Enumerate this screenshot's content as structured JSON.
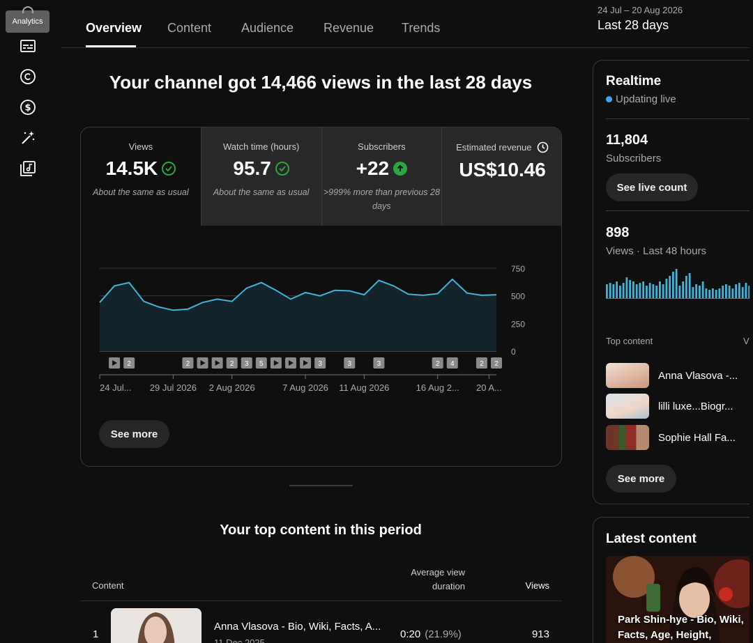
{
  "rail": {
    "tooltip": "Analytics",
    "icons": [
      "subtitles-icon",
      "copyright-icon",
      "earn-icon",
      "customization-icon",
      "audio-library-icon"
    ]
  },
  "tabs": [
    "Overview",
    "Content",
    "Audience",
    "Revenue",
    "Trends"
  ],
  "active_tab": "Overview",
  "date_range": {
    "range": "24 Jul – 20 Aug 2026",
    "label": "Last 28 days"
  },
  "headline": "Your channel got 14,466 views in the last 28 days",
  "metrics": [
    {
      "label": "Views",
      "value": "14.5K",
      "note": "About the same as usual",
      "status": "check"
    },
    {
      "label": "Watch time (hours)",
      "value": "95.7",
      "note": "About the same as usual",
      "status": "check"
    },
    {
      "label": "Subscribers",
      "value": "+22",
      "note": ">999% more than previous 28 days",
      "status": "up"
    },
    {
      "label": "Estimated revenue",
      "value": "US$10.46",
      "note": "",
      "status": "clock"
    }
  ],
  "chart_data": {
    "type": "area",
    "x_tick_labels": [
      "24 Jul...",
      "29 Jul 2026",
      "2 Aug 2026",
      "7 Aug 2026",
      "11 Aug 2026",
      "16 Aug 2...",
      "20 A..."
    ],
    "y_ticks": [
      0,
      250,
      500,
      750
    ],
    "ylim": [
      0,
      750
    ],
    "grid": true,
    "series": [
      {
        "values": [
          440,
          590,
          620,
          450,
          400,
          370,
          380,
          440,
          470,
          450,
          570,
          620,
          550,
          470,
          530,
          500,
          550,
          545,
          510,
          640,
          590,
          515,
          505,
          520,
          650,
          525,
          505,
          510
        ]
      }
    ],
    "event_markers": [
      {
        "day": 1,
        "kind": "play"
      },
      {
        "day": 2,
        "kind": "count",
        "count": "2"
      },
      {
        "day": 6,
        "kind": "count",
        "count": "2"
      },
      {
        "day": 7,
        "kind": "play"
      },
      {
        "day": 8,
        "kind": "play"
      },
      {
        "day": 9,
        "kind": "count",
        "count": "2"
      },
      {
        "day": 10,
        "kind": "count",
        "count": "3"
      },
      {
        "day": 11,
        "kind": "count",
        "count": "5"
      },
      {
        "day": 12,
        "kind": "play"
      },
      {
        "day": 13,
        "kind": "play"
      },
      {
        "day": 14,
        "kind": "play"
      },
      {
        "day": 15,
        "kind": "count",
        "count": "3"
      },
      {
        "day": 17,
        "kind": "count",
        "count": "3"
      },
      {
        "day": 19,
        "kind": "count",
        "count": "3"
      },
      {
        "day": 23,
        "kind": "count",
        "count": "2"
      },
      {
        "day": 24,
        "kind": "count",
        "count": "4"
      },
      {
        "day": 26,
        "kind": "count",
        "count": "2"
      },
      {
        "day": 27,
        "kind": "count",
        "count": "2"
      }
    ]
  },
  "see_more_label": "See more",
  "top_content": {
    "title": "Your top content in this period",
    "col_content": "Content",
    "col_avd": "Average view duration",
    "col_views": "Views",
    "rows": [
      {
        "rank": "1",
        "title": "Anna Vlasova - Bio, Wiki, Facts, A...",
        "date": "11 Dec 2025",
        "duration": "0:20",
        "pct": "(21.9%)",
        "views": "913"
      }
    ]
  },
  "realtime": {
    "title": "Realtime",
    "live": "Updating live",
    "subscribers": "11,804",
    "subscribers_label": "Subscribers",
    "see_live": "See live count",
    "views": "898",
    "views_label": "Views · Last 48 hours",
    "bars": [
      20,
      22,
      20,
      24,
      18,
      22,
      30,
      26,
      24,
      20,
      22,
      24,
      18,
      22,
      20,
      18,
      24,
      20,
      28,
      32,
      38,
      42,
      18,
      24,
      32,
      36,
      16,
      20,
      18,
      24,
      14,
      12,
      14,
      12,
      14,
      18,
      20,
      18,
      14,
      20,
      22,
      16,
      22,
      18
    ],
    "top_label": "Top content",
    "top_col": "Views",
    "items": [
      {
        "title": "Anna Vlasova -...",
        "color": "#e8cdb8"
      },
      {
        "title": "lilli luxe...Biogr...",
        "color": "#b8c9d9"
      },
      {
        "title": "Sophie Hall Fa...",
        "color": "#7a3b2e"
      }
    ]
  },
  "latest": {
    "title": "Latest content",
    "caption": "Park Shin-hye - Bio, Wiki, Facts, Age, Height, Weight,..."
  }
}
